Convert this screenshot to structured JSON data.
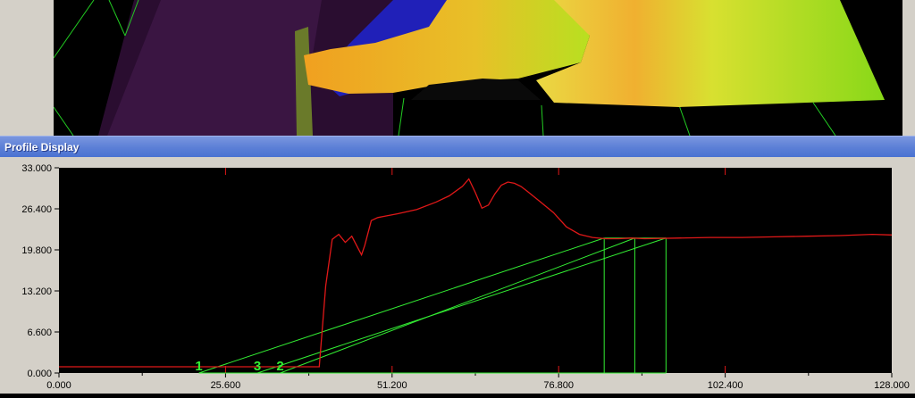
{
  "window": {
    "title": "Profile Display"
  },
  "colors": {
    "plot_background": "#000000",
    "profile_line": "#e01818",
    "markers": "#33ee33",
    "window_face": "#d4d0c8",
    "titlebar": "#5b7fd6"
  },
  "markers": [
    {
      "label": "1",
      "x": 21.5
    },
    {
      "label": "3",
      "x": 30.5
    },
    {
      "label": "2",
      "x": 34.0
    }
  ],
  "chart_data": {
    "type": "line",
    "title": "",
    "xlabel": "",
    "ylabel": "",
    "xlim": [
      0,
      128
    ],
    "ylim": [
      0,
      33
    ],
    "x_ticks": [
      "0.000",
      "25.600",
      "51.200",
      "76.800",
      "102.400",
      "128.000"
    ],
    "y_ticks": [
      "0.000",
      "6.600",
      "13.200",
      "19.800",
      "26.400",
      "33.000"
    ],
    "grid": false,
    "series": [
      {
        "x": [
          0,
          10,
          20,
          30,
          36,
          40,
          41,
          42,
          43,
          44,
          45,
          46,
          46.5,
          47,
          48,
          49,
          50,
          52,
          55,
          58,
          60,
          62,
          63,
          64,
          65,
          66,
          67,
          68,
          69,
          70,
          71,
          72,
          74,
          76,
          78,
          80,
          82,
          84,
          86,
          88,
          90,
          95,
          100,
          105,
          110,
          115,
          120,
          125,
          128
        ],
        "y": [
          1.0,
          1.0,
          1.0,
          1.0,
          1.0,
          1.0,
          14.0,
          21.5,
          22.3,
          21.0,
          22.0,
          20.0,
          19.0,
          20.5,
          24.5,
          25.0,
          25.2,
          25.6,
          26.3,
          27.5,
          28.5,
          30.0,
          31.2,
          29.0,
          26.5,
          27.0,
          28.8,
          30.2,
          30.7,
          30.5,
          30.0,
          29.2,
          27.5,
          25.8,
          23.5,
          22.3,
          21.8,
          21.6,
          21.6,
          21.7,
          21.6,
          21.7,
          21.8,
          21.8,
          21.9,
          22.0,
          22.1,
          22.3,
          22.2
        ]
      }
    ]
  }
}
